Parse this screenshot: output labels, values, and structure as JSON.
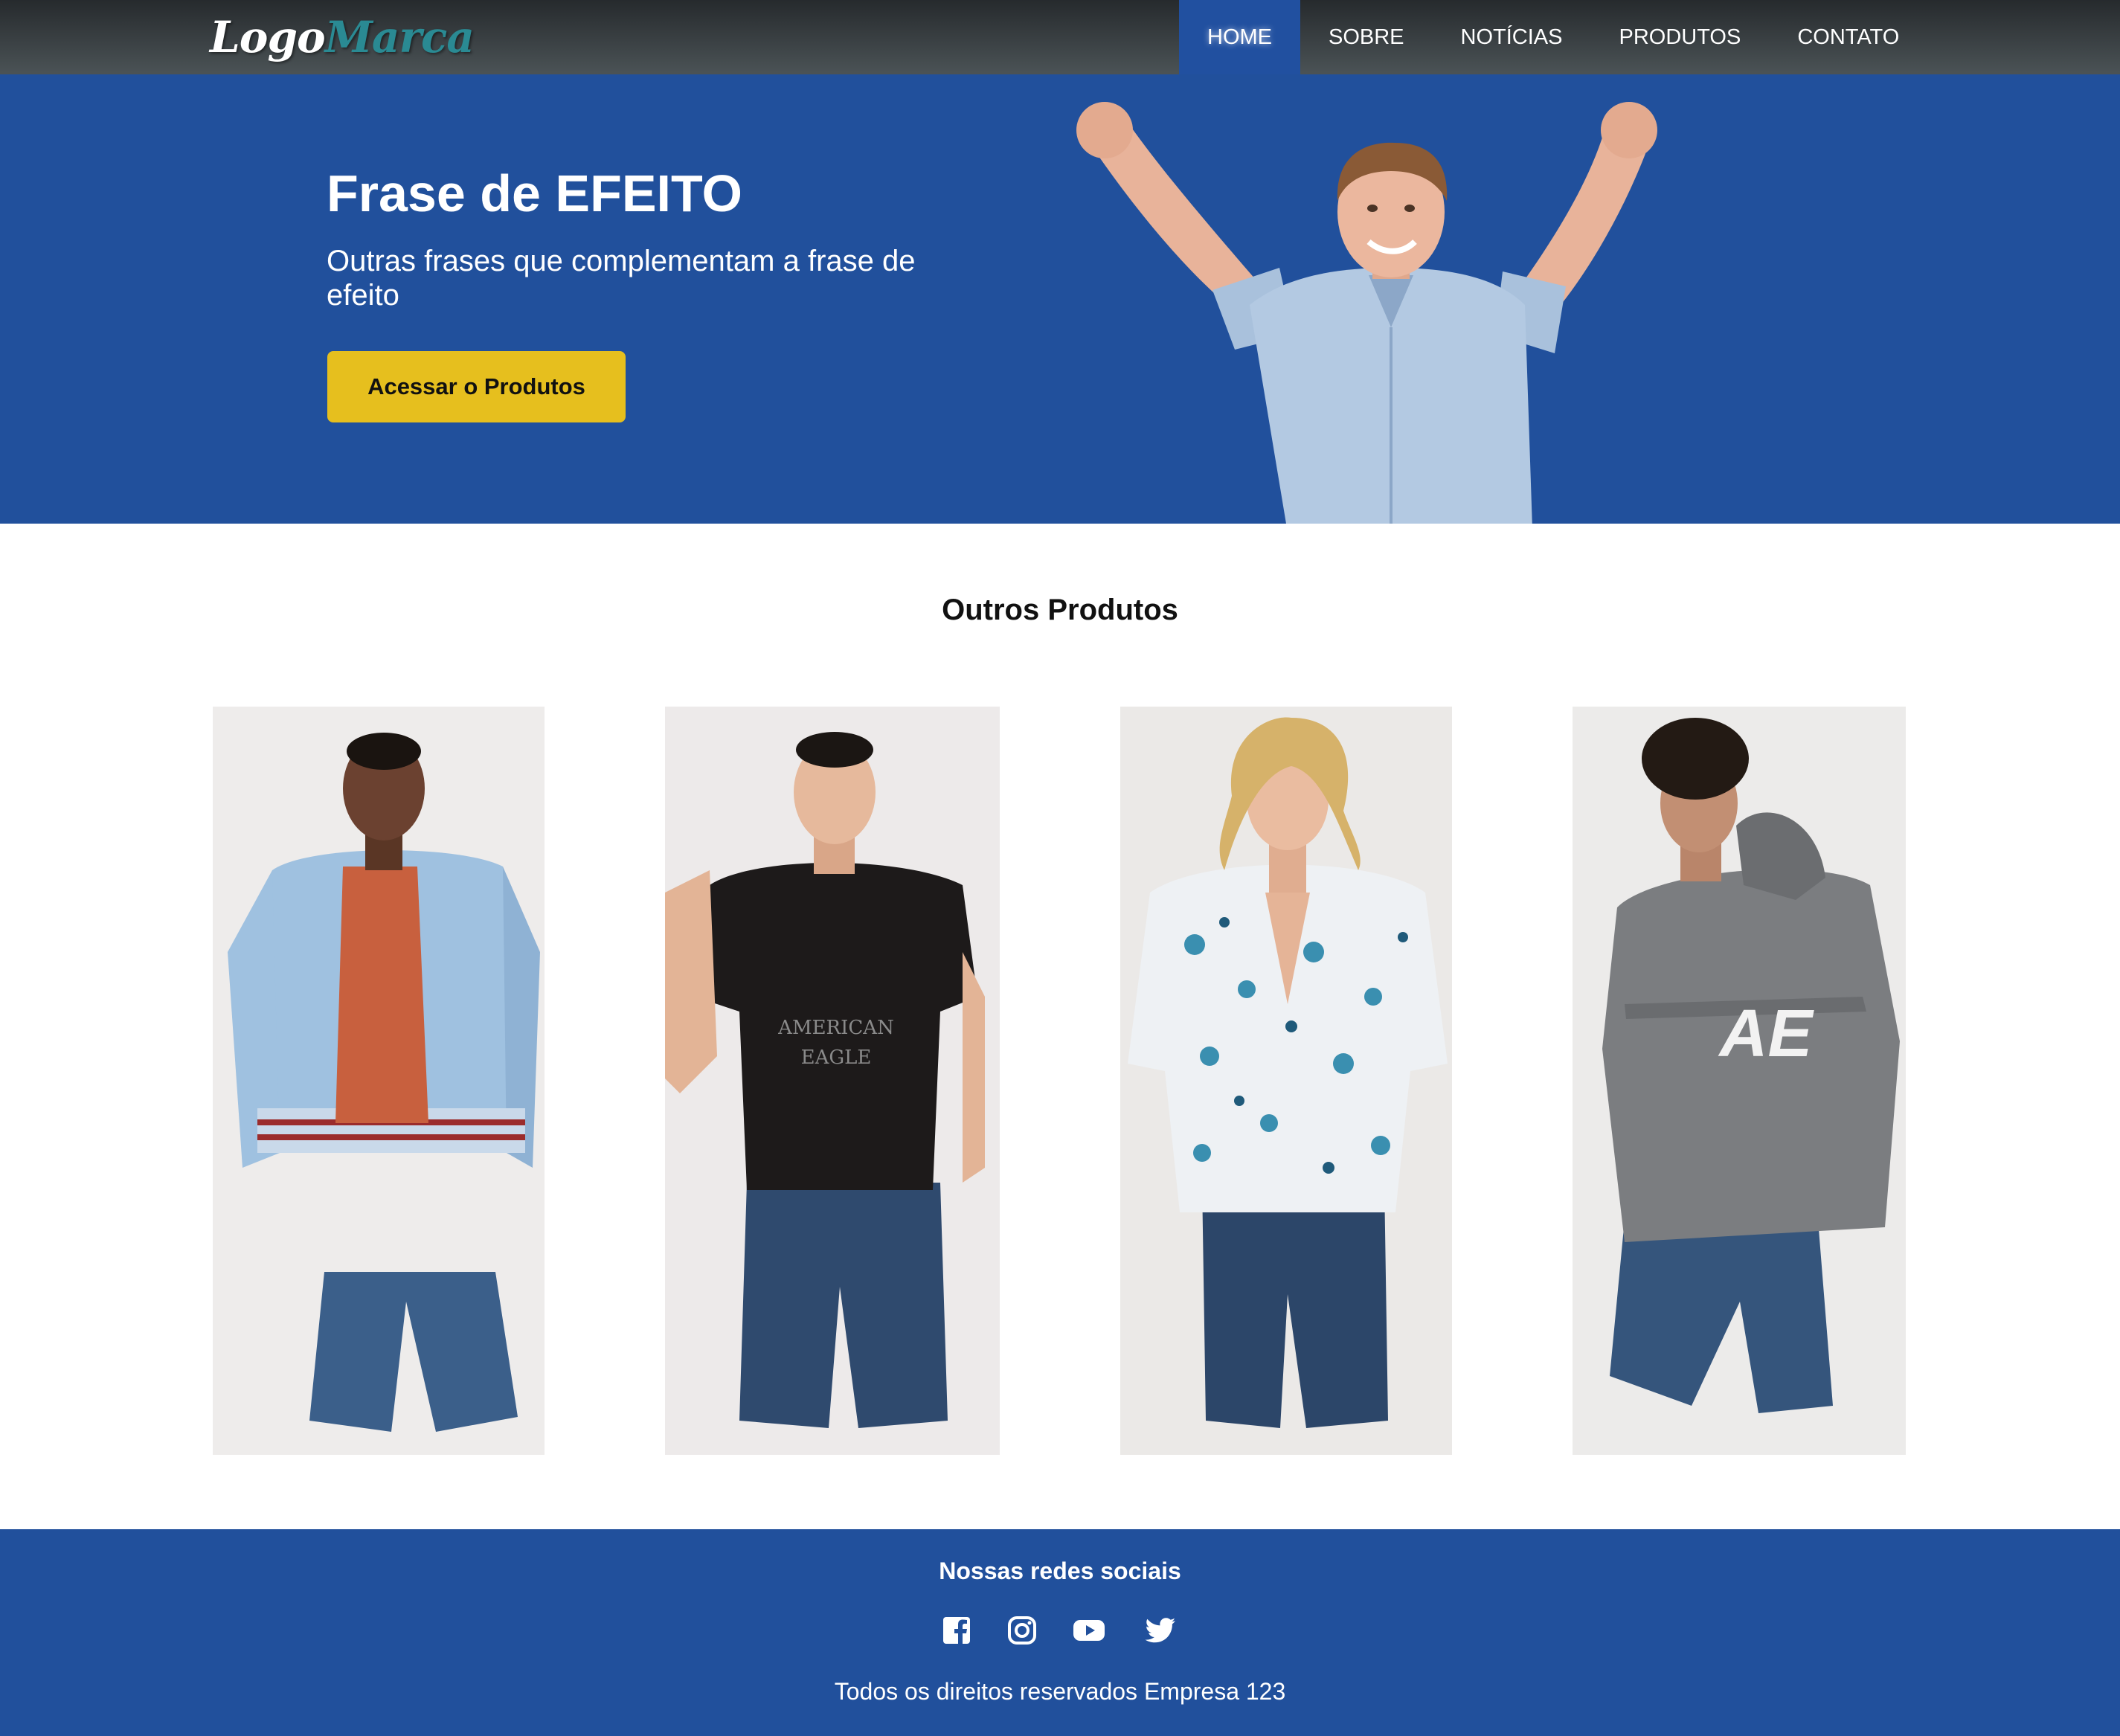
{
  "header": {
    "logo": {
      "part1": "Logo",
      "part2": "Marca"
    },
    "nav": [
      {
        "label": "HOME",
        "active": true
      },
      {
        "label": "SOBRE"
      },
      {
        "label": "NOTÍCIAS"
      },
      {
        "label": "PRODUTOS"
      },
      {
        "label": "CONTATO"
      }
    ]
  },
  "hero": {
    "title": "Frase de EFEITO",
    "subtitle": "Outras frases que complementam a frase de efeito",
    "button_label": "Acessar o Produtos"
  },
  "products": {
    "title": "Outros Produtos",
    "items": [
      {
        "image": "man-in-blue-bomber-jacket-and-denim-shorts"
      },
      {
        "image": "man-in-black-american-eagle-tee-and-denim-shorts"
      },
      {
        "image": "man-in-printed-floral-shirt-and-denim-shorts"
      },
      {
        "image": "man-in-grey-ae-hoodie-and-denim-shorts"
      }
    ]
  },
  "footer": {
    "social_title": "Nossas redes sociais",
    "social_icons": [
      "facebook-icon",
      "instagram-icon",
      "youtube-icon",
      "twitter-icon"
    ],
    "copyright": "Todos os direitos reservados Empresa 123"
  },
  "colors": {
    "nav_gradient_top": "#262a2d",
    "nav_gradient_bottom": "#4b5356",
    "brand_blue": "#21509c",
    "button_yellow": "#e6bf1e",
    "logo_accent": "#2a8a93"
  }
}
